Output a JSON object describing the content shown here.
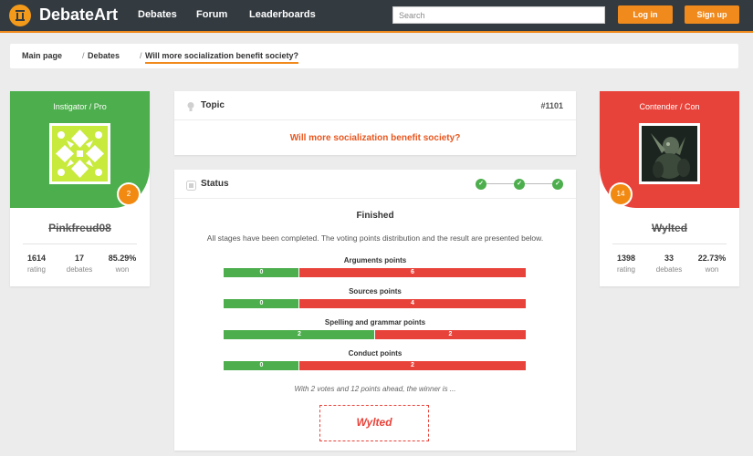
{
  "nav": {
    "logo_text": "DebateArt",
    "links": [
      "Debates",
      "Forum",
      "Leaderboards"
    ],
    "search_placeholder": "Search",
    "login_label": "Log in",
    "signup_label": "Sign up"
  },
  "breadcrumb": {
    "items": [
      "Main page",
      "Debates",
      "Will more socialization benefit society?"
    ],
    "separator": "/"
  },
  "instigator": {
    "role": "Instigator / Pro",
    "badge": "2",
    "username": "Pinkfreud08",
    "stats": [
      {
        "value": "1614",
        "label": "rating"
      },
      {
        "value": "17",
        "label": "debates"
      },
      {
        "value": "85.29%",
        "label": "won"
      }
    ]
  },
  "contender": {
    "role": "Contender / Con",
    "badge": "14",
    "username": "Wylted",
    "stats": [
      {
        "value": "1398",
        "label": "rating"
      },
      {
        "value": "33",
        "label": "debates"
      },
      {
        "value": "22.73%",
        "label": "won"
      }
    ]
  },
  "topic": {
    "heading": "Topic",
    "id": "#1101",
    "text": "Will more socialization benefit society?"
  },
  "status": {
    "heading": "Status",
    "step_icon": "check-icon",
    "state": "Finished",
    "description": "All stages have been completed. The voting points distribution and the result are presented below.",
    "categories": [
      {
        "label": "Arguments points",
        "pro": 0,
        "con": 6,
        "pro_fraction": 0.25
      },
      {
        "label": "Sources points",
        "pro": 0,
        "con": 4,
        "pro_fraction": 0.25
      },
      {
        "label": "Spelling and grammar points",
        "pro": 2,
        "con": 2,
        "pro_fraction": 0.5
      },
      {
        "label": "Conduct points",
        "pro": 0,
        "con": 2,
        "pro_fraction": 0.25
      }
    ],
    "summary": "With 2 votes and 12 points ahead, the winner is ...",
    "winner": "Wylted"
  },
  "colors": {
    "accent": "#f08a1c",
    "pro": "#4cae4c",
    "con": "#e8433a",
    "topic_text": "#e8561e",
    "navbar": "#333a40"
  }
}
